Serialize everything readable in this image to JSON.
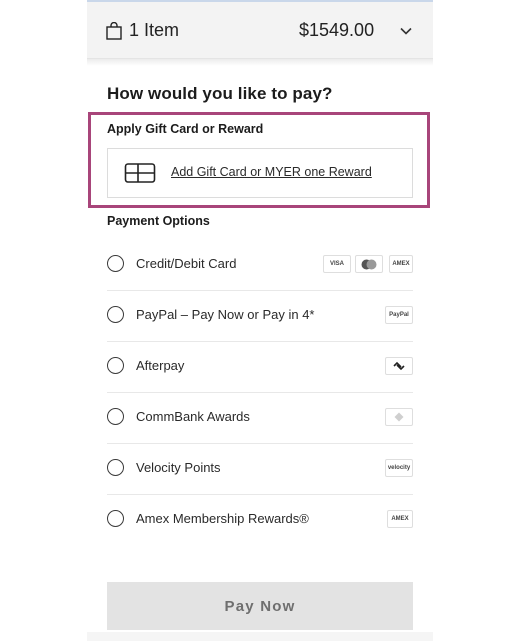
{
  "summary": {
    "item_count": "1 Item",
    "total": "$1549.00"
  },
  "heading": "How would you like to pay?",
  "gift": {
    "title": "Apply Gift Card or Reward",
    "link": "Add Gift Card or MYER one Reward"
  },
  "payment_options": {
    "title": "Payment Options",
    "items": [
      {
        "label": "Credit/Debit Card",
        "logos": [
          "VISA",
          "",
          "AMEX"
        ]
      },
      {
        "label": "PayPal – Pay Now or Pay in 4*",
        "logos": [
          "PayPal"
        ]
      },
      {
        "label": "Afterpay",
        "logos": [
          ""
        ]
      },
      {
        "label": "CommBank Awards",
        "logos": [
          ""
        ]
      },
      {
        "label": "Velocity Points",
        "logos": [
          "velocity"
        ]
      },
      {
        "label": "Amex Membership Rewards®",
        "logos": [
          "AMEX"
        ]
      }
    ]
  },
  "pay_button": "Pay Now",
  "colors": {
    "highlight": "#a8457a",
    "summary_bg": "#f3f3f3",
    "button_bg": "#e3e3e3"
  },
  "icons": {
    "bag": "shopping-bag-icon",
    "chevron": "chevron-down-icon",
    "card": "gift-card-icon"
  }
}
